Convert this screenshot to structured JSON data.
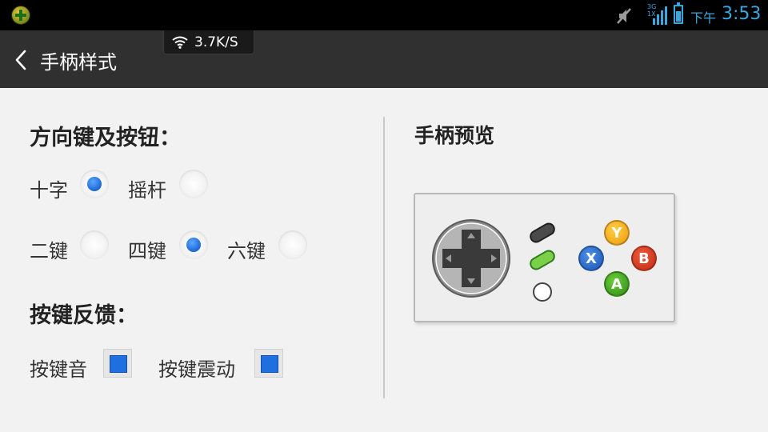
{
  "status_bar": {
    "network_label": "3G\n1X",
    "clock_ampm": "下午",
    "clock_time": "3:53",
    "battery_level": 0.7,
    "icons": [
      "app-notification-icon",
      "mute-icon",
      "signal-icon",
      "battery-icon"
    ],
    "accent_color": "#38a8e0"
  },
  "action_bar": {
    "title": "手柄样式",
    "back_icon": "chevron-left-icon"
  },
  "speed_overlay": {
    "value": "3.7K/S",
    "icon": "wifi-icon"
  },
  "settings": {
    "direction_section": {
      "title": "方向键及按钮：",
      "dpad_style": [
        {
          "label": "十字",
          "checked": true
        },
        {
          "label": "摇杆",
          "checked": false
        }
      ],
      "button_count": [
        {
          "label": "二键",
          "checked": false
        },
        {
          "label": "四键",
          "checked": true
        },
        {
          "label": "六键",
          "checked": false
        }
      ]
    },
    "feedback_section": {
      "title": "按键反馈：",
      "options": [
        {
          "label": "按键音",
          "checked": true
        },
        {
          "label": "按键震动",
          "checked": true
        }
      ]
    }
  },
  "preview": {
    "title": "手柄预览",
    "face_buttons": {
      "y": "Y",
      "x": "X",
      "b": "B",
      "a": "A"
    }
  }
}
